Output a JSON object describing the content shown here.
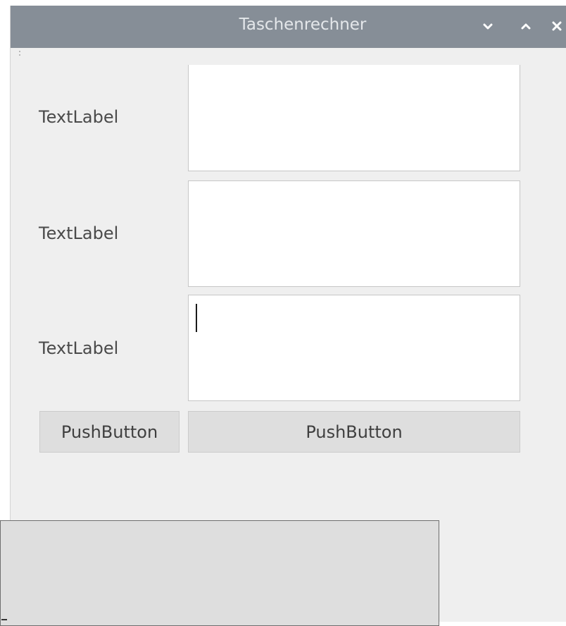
{
  "window": {
    "title": "Taschenrechner"
  },
  "titlebar_icons": {
    "minimize": "chevron-down-icon",
    "maximize": "chevron-up-icon",
    "close": "close-icon"
  },
  "form": {
    "rows": [
      {
        "label": "TextLabel",
        "value": ""
      },
      {
        "label": "TextLabel",
        "value": ""
      },
      {
        "label": "TextLabel",
        "value": ""
      }
    ],
    "buttons": {
      "left": "PushButton",
      "right": "PushButton"
    }
  },
  "colors": {
    "titlebar": "#868e97",
    "window_bg": "#efefef",
    "button_bg": "#dedede",
    "field_bg": "#ffffff"
  }
}
